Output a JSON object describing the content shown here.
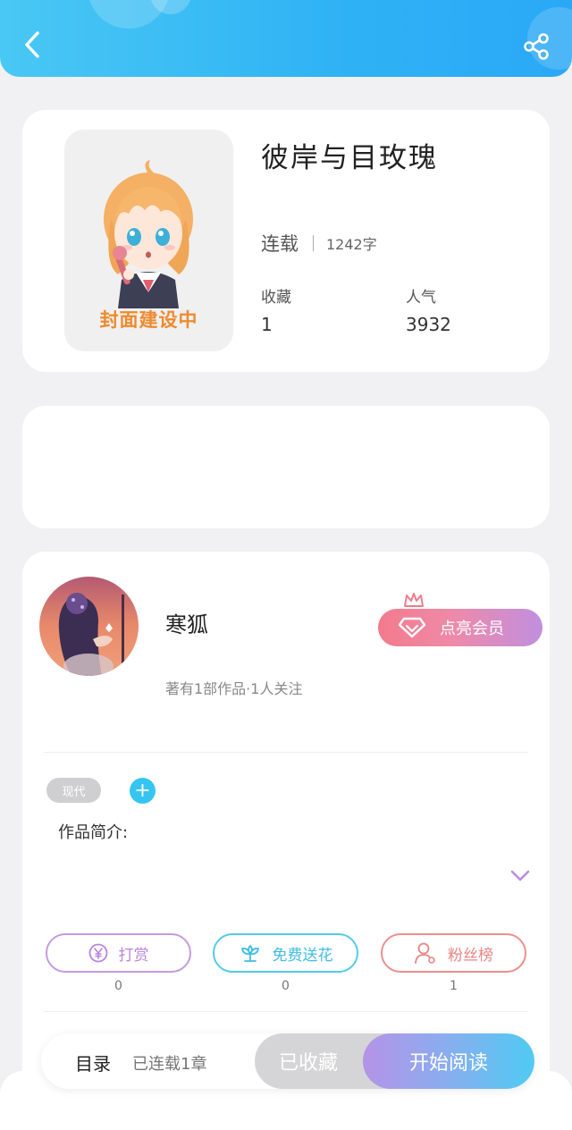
{
  "header": {
    "back_icon": "chevron-left-icon",
    "share_icon": "share-icon"
  },
  "book": {
    "cover_text": "封面建设中",
    "title": "彼岸与目玫瑰",
    "status": "连载",
    "word_count": "1242字",
    "favorites_label": "收藏",
    "favorites_value": "1",
    "popularity_label": "人气",
    "popularity_value": "3932"
  },
  "author": {
    "name": "寒狐",
    "meta": "著有1部作品·1人关注",
    "vip_label": "点亮会员",
    "tag": "现代",
    "intro_label": "作品简介:"
  },
  "actions": [
    {
      "label": "打赏",
      "count": "0",
      "icon": "yen-icon",
      "color": "#b884dd"
    },
    {
      "label": "免费送花",
      "count": "0",
      "icon": "flower-icon",
      "color": "#3fbde4"
    },
    {
      "label": "粉丝榜",
      "count": "1",
      "icon": "user-icon",
      "color": "#e88585"
    }
  ],
  "bottom_bar": {
    "toc_label": "目录",
    "chapter_info": "已连载1章",
    "collected_label": "已收藏",
    "read_label": "开始阅读"
  },
  "colors": {
    "accent": "#2fb2f5",
    "vip_gradient_start": "#f47a8c",
    "vip_gradient_end": "#c08fe0"
  }
}
